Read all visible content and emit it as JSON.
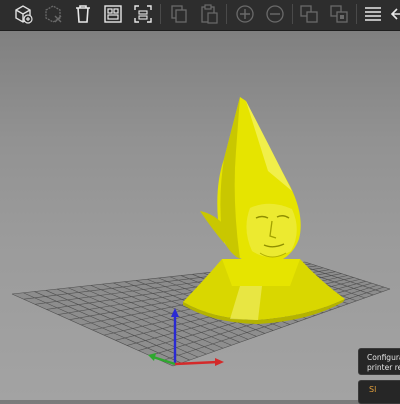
{
  "toolbar": {
    "buttons": [
      {
        "name": "add-object-icon",
        "enabled": true
      },
      {
        "name": "delete-icon",
        "enabled": false
      },
      {
        "name": "delete-all-icon",
        "enabled": true
      },
      {
        "name": "arrange-icon",
        "enabled": true
      },
      {
        "name": "split-icon",
        "enabled": true
      },
      {
        "name": "copy-icon",
        "enabled": false
      },
      {
        "name": "paste-icon",
        "enabled": false
      },
      {
        "name": "add-instance-icon",
        "enabled": false
      },
      {
        "name": "remove-instance-icon",
        "enabled": false
      },
      {
        "name": "split-objects-icon",
        "enabled": false
      },
      {
        "name": "split-parts-icon",
        "enabled": false
      },
      {
        "name": "undo-icon",
        "enabled": true
      },
      {
        "name": "layers-editing-icon",
        "enabled": true
      }
    ]
  },
  "colors": {
    "model": "#e8e600",
    "bed_grid": "#5a5a5a",
    "axis_x": "#d42a2a",
    "axis_y": "#2ea82e",
    "axis_z": "#2a2ad4"
  },
  "notification": {
    "line1": "Configurati",
    "line2": "printer rele",
    "line3": "Sl"
  }
}
